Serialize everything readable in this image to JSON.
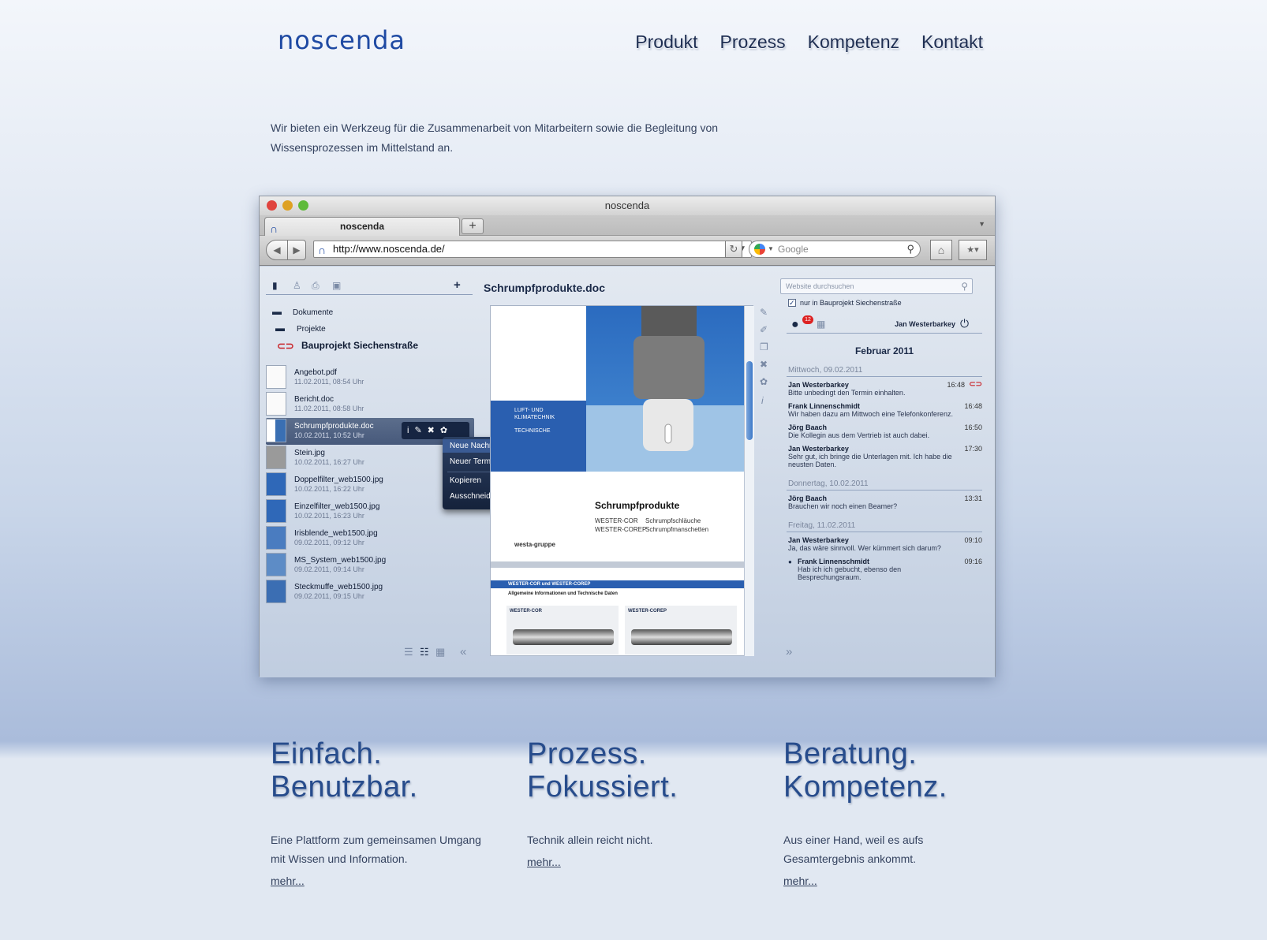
{
  "header": {
    "logo_text": "noscenda",
    "nav": [
      "Produkt",
      "Prozess",
      "Kompetenz",
      "Kontakt"
    ]
  },
  "intro": "Wir bieten ein Werkzeug für die Zusammenarbeit von Mitarbeitern sowie die Begleitung von Wissensprozessen im Mittelstand an.",
  "browser": {
    "window_title": "noscenda",
    "tab_title": "noscenda",
    "new_tab": "+",
    "url": "http://www.noscenda.de/",
    "search_placeholder": "Google"
  },
  "app": {
    "sidebar": {
      "tree": [
        "Dokumente",
        "Projekte"
      ],
      "project": "Bauprojekt Siechenstraße",
      "files": [
        {
          "name": "Angebot.pdf",
          "date": "11.02.2011, 08:54 Uhr"
        },
        {
          "name": "Bericht.doc",
          "date": "11.02.2011, 08:58 Uhr"
        },
        {
          "name": "Schrumpfprodukte.doc",
          "date": "10.02.2011, 10:52 Uhr"
        },
        {
          "name": "Stein.jpg",
          "date": "10.02.2011, 16:27 Uhr"
        },
        {
          "name": "Doppelfilter_web1500.jpg",
          "date": "10.02.2011, 16:22 Uhr"
        },
        {
          "name": "Einzelfilter_web1500.jpg",
          "date": "10.02.2011, 16:23 Uhr"
        },
        {
          "name": "Irisblende_web1500.jpg",
          "date": "09.02.2011, 09:12 Uhr"
        },
        {
          "name": "MS_System_web1500.jpg",
          "date": "09.02.2011, 09:14 Uhr"
        },
        {
          "name": "Steckmuffe_web1500.jpg",
          "date": "09.02.2011, 09:15 Uhr"
        }
      ]
    },
    "context_menu": [
      "Neue Nachricht hierzu...",
      "Neuer Termin hierzu...",
      "Kopieren",
      "Ausschneiden"
    ],
    "document": {
      "title": "Schrumpfprodukte.doc",
      "cover_label_1": "LUFT- UND",
      "cover_label_2": "KLIMATECHNIK",
      "cover_label_3": "TECHNISCHE",
      "cover_heading": "Schrumpfprodukte",
      "line1_a": "WESTER-COR",
      "line1_b": "Schrumpfschläuche",
      "line2_a": "WESTER-COREP",
      "line2_b": "Schrumpfmanschetten",
      "brand": "westa-gruppe",
      "page2_band": "WESTER-COR und WESTER-COREP",
      "page2_sub": "Allgemeine Informationen und Technische Daten",
      "page2_box1": "WESTER-COR",
      "page2_box2": "WESTER-COREP"
    },
    "right": {
      "search_placeholder": "Website durchsuchen",
      "checkbox_label": "nur in Bauprojekt Siechenstraße",
      "badge": "12",
      "user": "Jan Westerbarkey",
      "month": "Februar 2011",
      "days": [
        {
          "label": "Mittwoch, 09.02.2011",
          "messages": [
            {
              "name": "Jan Westerbarkey",
              "time": "16:48",
              "text": "Bitte unbedingt den Termin einhalten."
            },
            {
              "name": "Frank Linnenschmidt",
              "time": "16:48",
              "text": "Wir haben dazu am Mittwoch eine Telefonkonferenz."
            },
            {
              "name": "Jörg Baach",
              "time": "16:50",
              "text": "Die Kollegin aus dem Vertrieb ist auch dabei."
            },
            {
              "name": "Jan Westerbarkey",
              "time": "17:30",
              "text": "Sehr gut, ich bringe die Unterlagen mit. Ich habe die neusten Daten."
            }
          ]
        },
        {
          "label": "Donnertag, 10.02.2011",
          "messages": [
            {
              "name": "Jörg Baach",
              "time": "13:31",
              "text": "Brauchen wir noch einen Beamer?"
            }
          ]
        },
        {
          "label": "Freitag, 11.02.2011",
          "messages": [
            {
              "name": "Jan Westerbarkey",
              "time": "09:10",
              "text": "Ja, das wäre sinnvoll. Wer kümmert sich darum?"
            },
            {
              "name": "Frank Linnenschmidt",
              "time": "09:16",
              "text": "Hab ich ich gebucht, ebenso den Besprechungsraum."
            }
          ]
        }
      ]
    }
  },
  "features": [
    {
      "line1": "Einfach.",
      "line2": "Benutzbar.",
      "text": "Eine Plattform zum gemeinsamen Umgang mit Wissen und Information.",
      "more": "mehr..."
    },
    {
      "line1": "Prozess.",
      "line2": "Fokussiert.",
      "text": "Technik allein reicht nicht.",
      "more": "mehr..."
    },
    {
      "line1": "Beratung.",
      "line2": "Kompetenz.",
      "text": "Aus einer Hand, weil es aufs Gesamtergebnis ankommt.",
      "more": "mehr..."
    }
  ]
}
